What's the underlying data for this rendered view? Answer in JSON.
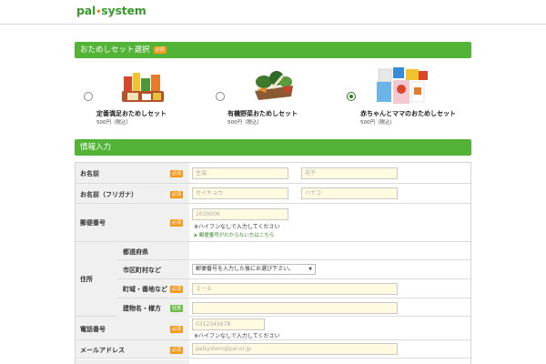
{
  "header": {
    "logo_left": "pal",
    "logo_dot": "•",
    "logo_right": "system"
  },
  "set_section": {
    "title": "おためしセット選択",
    "required_badge": "必須"
  },
  "sets": [
    {
      "name": "定番満足おためしセット",
      "price": "500円（税込）",
      "selected": false,
      "image": "grocery-products-image"
    },
    {
      "name": "有機野菜おためしセット",
      "price": "500円（税込）",
      "selected": false,
      "image": "vegetable-basket-image"
    },
    {
      "name": "赤ちゃんとママのおためしセット",
      "price": "500円（税込）",
      "selected": true,
      "image": "baby-products-image"
    }
  ],
  "info_section": {
    "title": "情報入力"
  },
  "form": {
    "required": "必須",
    "optional": "任意",
    "name": {
      "label": "お名前",
      "last_placeholder": "生協",
      "first_placeholder": "花子"
    },
    "kana": {
      "label": "お名前（フリガナ）",
      "last_placeholder": "セイキョウ",
      "first_placeholder": "ハナコ"
    },
    "postal": {
      "label": "郵便番号",
      "placeholder": "1630006",
      "note": "※ハイフンなしで入力してください",
      "link": "郵便番号がわからない方はこちら"
    },
    "address": {
      "label": "住所",
      "prefecture_label": "都道府県",
      "city_label": "市区町村など",
      "city_select": "郵便番号を入力した後にお選び下さい。",
      "street_label": "町域・番地など",
      "street_placeholder": "２－６",
      "building_label": "建物名・様方"
    },
    "phone": {
      "label": "電話番号",
      "placeholder": "0312345678",
      "note": "※ハイフンなしで入力してください"
    },
    "email": {
      "label": "メールアドレス",
      "placeholder": "palsystem@pal.or.jp"
    }
  },
  "colors": {
    "brand_green": "#52b336",
    "badge_orange": "#f39a1d",
    "input_bg": "#fffae0"
  }
}
